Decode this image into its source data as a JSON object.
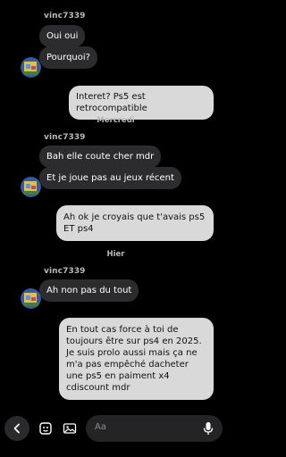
{
  "messages": [
    {
      "sender": "vinc7339"
    },
    {
      "text": "Oui oui"
    },
    {
      "text": "Pourquoi?"
    },
    {
      "text": "Interet? Ps5 est retrocompatible"
    },
    {
      "divider": "Mercredi"
    },
    {
      "sender": "vinc7339"
    },
    {
      "text": "Bah elle coute cher mdr"
    },
    {
      "text": "Et je joue pas au jeux récent"
    },
    {
      "text": "Ah ok je croyais que t'avais ps5 ET ps4"
    },
    {
      "divider": "Hier"
    },
    {
      "sender": "vinc7339"
    },
    {
      "text": "Ah non pas du tout"
    },
    {
      "text": "En tout cas force à toi de toujours être sur ps4 en 2025. Je suis prolo aussi mais ça ne m'a pas empêché dacheter une ps5 en paiment x4 cdiscount mdr"
    }
  ],
  "composer": {
    "placeholder": "Aa"
  },
  "colors": {
    "incoming_bubble": "#2c2c2e",
    "outgoing_bubble": "#d9d9d9",
    "background": "#000000"
  }
}
